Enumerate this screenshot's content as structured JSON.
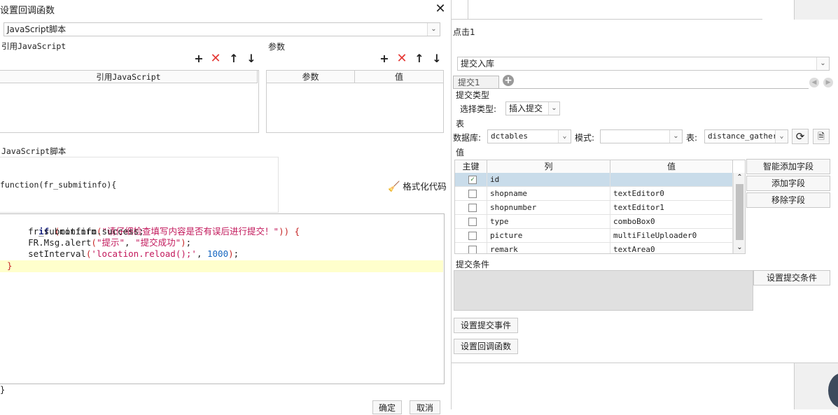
{
  "dialog": {
    "title": "设置回调函数",
    "script_type_select": "JavaScript脚本",
    "ref_js_section_label": "引用JavaScript",
    "ref_js_table_header": "引用JavaScript",
    "params_section_label": "参数",
    "params_table_headers": [
      "参数",
      "值"
    ],
    "js_script_label": "JavaScript脚本",
    "function_signature": "function(fr_submitinfo){",
    "format_code_label": "格式化代码",
    "closing_brace": "}",
    "code_lines": [
      {
        "text": "if (confirm(\"请仔细检查填写内容是否有误后进行提交！\")) {"
      },
      {
        "text": "    fr_submitinfo.success;"
      },
      {
        "text": "    FR.Msg.alert(\"提示\", \"提交成功\");"
      },
      {
        "text": "    setInterval('location.reload();', 1000);"
      },
      {
        "text": "}"
      }
    ],
    "ok_label": "确定",
    "cancel_label": "取消"
  },
  "right": {
    "click_label": "点击1",
    "submit_type_select": "提交入库",
    "tab_label": "提交1",
    "submit_type_section": "提交类型",
    "choose_type_label": "选择类型:",
    "choose_type_value": "插入提交",
    "table_section": "表",
    "db_label": "数据库:",
    "db_value": "dctables",
    "mode_label": "模式:",
    "mode_value": "",
    "table_label": "表:",
    "table_value": "distance_gather",
    "values_section": "值",
    "columns": [
      "主键",
      "列",
      "值"
    ],
    "rows": [
      {
        "pk": true,
        "col": "id",
        "val": ""
      },
      {
        "pk": false,
        "col": "shopname",
        "val": "textEditor0"
      },
      {
        "pk": false,
        "col": "shopnumber",
        "val": "textEditor1"
      },
      {
        "pk": false,
        "col": "type",
        "val": "comboBox0"
      },
      {
        "pk": false,
        "col": "picture",
        "val": "multiFileUploader0"
      },
      {
        "pk": false,
        "col": "remark",
        "val": "textArea0"
      }
    ],
    "smart_add_label": "智能添加字段",
    "add_field_label": "添加字段",
    "remove_field_label": "移除字段",
    "submit_condition_section": "提交条件",
    "set_condition_label": "设置提交条件",
    "set_event_label": "设置提交事件",
    "set_callback_label": "设置回调函数"
  }
}
